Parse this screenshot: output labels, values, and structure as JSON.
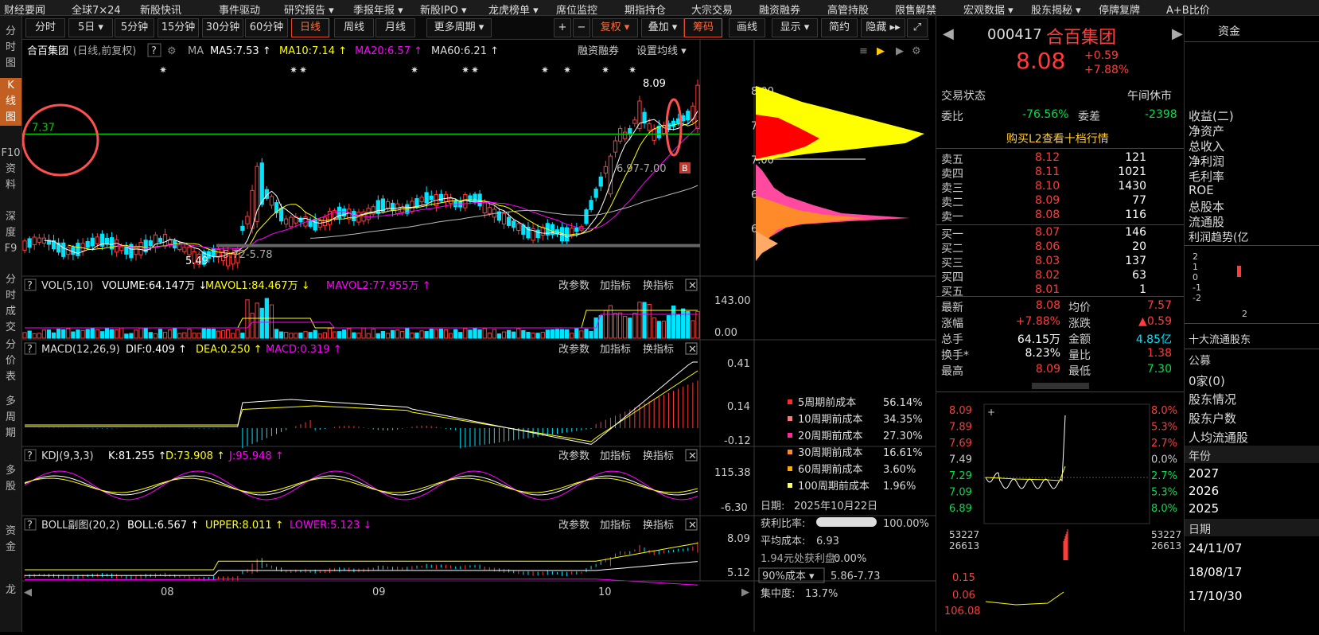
{
  "topnav": [
    "财经要闻",
    "全球7×24",
    "新股快讯",
    "事件驱动",
    "研究报告 ▾",
    "季报年报 ▾",
    "新股IPO ▾",
    "龙虎榜单 ▾",
    "席位监控",
    "期指持仓",
    "大宗交易",
    "融资融券",
    "高管持股",
    "限售解禁",
    "宏观数据 ▾",
    "股东揭秘 ▾",
    "停牌复牌",
    "A+B比价"
  ],
  "leftnav": [
    "分\n时\n图",
    "K\n线\n图",
    "F10\n资\n料",
    "深\n度\nF9",
    "分\n时\n成\n交",
    "分\n价\n表",
    "多\n周\n期",
    "多\n股",
    "资\n金",
    "龙"
  ],
  "toolbar": {
    "items": [
      "分时",
      "5日 ▾",
      "5分钟",
      "15分钟",
      "30分钟",
      "60分钟",
      "日线",
      "周线",
      "月线",
      "更多周期 ▾",
      "+",
      "−",
      "复权 ▾",
      "叠加 ▾",
      "筹码",
      "画线",
      "显示 ▾",
      "简约",
      "隐藏 ▸▸",
      "⤢"
    ]
  },
  "main": {
    "stock": "合百集团",
    "mode": "(日线,前复权)",
    "help": "?",
    "ma_label": "MA",
    "ma5": "MA5:7.53 ↑",
    "ma10": "MA10:7.14 ↑",
    "ma20": "MA20:6.57 ↑",
    "ma60": "MA60:6.21 ↑",
    "margin": "融资融券",
    "settings": "设置均线 ▾",
    "high_mark": "8.09",
    "low_mark": "5.49",
    "hline": "7.37",
    "range1": "5.72-5.78",
    "range2": "6.97-7.00",
    "b_badge": "B",
    "price_axis": [
      "8.00",
      "7.50",
      "7.00",
      "6.50",
      "6.00"
    ]
  },
  "vol": {
    "title": "VOL(5,10)",
    "volume": "VOLUME:64.147万 ↓",
    "mavol1": "MAVOL1:84.467万 ↓",
    "mavol2": "MAVOL2:77.955万 ↑",
    "axis": [
      "143.00",
      "0.00"
    ]
  },
  "macd": {
    "title": "MACD(12,26,9)",
    "dif": "DIF:0.409 ↑",
    "dea": "DEA:0.250 ↑",
    "macd": "MACD:0.319 ↑",
    "axis": [
      "0.41",
      "0.14",
      "-0.12"
    ]
  },
  "kdj": {
    "title": "KDJ(9,3,3)",
    "k": "K:81.255 ↑",
    "d": "D:73.908 ↑",
    "j": "J:95.948 ↑",
    "axis": [
      "115.38",
      "-6.30"
    ]
  },
  "boll": {
    "title": "BOLL副图(20,2)",
    "boll": "BOLL:6.567 ↑",
    "upper": "UPPER:8.011 ↑",
    "lower": "LOWER:5.123 ↓",
    "axis": [
      "8.09",
      "5.12"
    ]
  },
  "panel_actions": [
    "改参数",
    "加指标",
    "换指标"
  ],
  "xaxis": [
    "08",
    "09",
    "10"
  ],
  "chip": {
    "legend": [
      {
        "label": "5周期前成本",
        "value": "56.14%",
        "color": "#ff2a2a"
      },
      {
        "label": "10周期前成本",
        "value": "34.35%",
        "color": "#ff7777"
      },
      {
        "label": "20周期前成本",
        "value": "27.30%",
        "color": "#ff2aa0"
      },
      {
        "label": "30周期前成本",
        "value": "16.61%",
        "color": "#ff8a2a"
      },
      {
        "label": "60周期前成本",
        "value": "3.60%",
        "color": "#ffaa00"
      },
      {
        "label": "100周期前成本",
        "value": "1.96%",
        "color": "#ffff66"
      }
    ],
    "date_label": "日期:",
    "date": "2025年10月22日",
    "ratio_label": "获利比率:",
    "ratio": "100.00%",
    "avg_label": "平均成本:",
    "avg": "6.93",
    "profit_label": "1.94元处获利盘:",
    "profit": "0.00%",
    "cost_select": "90%成本 ▾",
    "cost_range": "5.86-7.73",
    "conc_label": "集中度:",
    "conc": "13.7%"
  },
  "right": {
    "code": "000417",
    "name": "合百集团",
    "price": "8.08",
    "change": "+0.59",
    "pct": "+7.88%",
    "status_label": "交易状态",
    "status": "午间休市",
    "wb_label": "委比",
    "wb": "-76.56%",
    "wc_label": "委差",
    "wc": "-2398",
    "l2": "购买L2查看十档行情",
    "sell": [
      {
        "l": "卖五",
        "p": "8.12",
        "v": "121"
      },
      {
        "l": "卖四",
        "p": "8.11",
        "v": "1021"
      },
      {
        "l": "卖三",
        "p": "8.10",
        "v": "1430"
      },
      {
        "l": "卖二",
        "p": "8.09",
        "v": "77"
      },
      {
        "l": "卖一",
        "p": "8.08",
        "v": "116"
      }
    ],
    "buy": [
      {
        "l": "买一",
        "p": "8.07",
        "v": "146"
      },
      {
        "l": "买二",
        "p": "8.06",
        "v": "20"
      },
      {
        "l": "买三",
        "p": "8.03",
        "v": "137"
      },
      {
        "l": "买四",
        "p": "8.02",
        "v": "63"
      },
      {
        "l": "买五",
        "p": "8.01",
        "v": "1"
      }
    ],
    "stats": [
      [
        "最新",
        "8.08",
        "均价",
        "7.57"
      ],
      [
        "涨幅",
        "+7.88%",
        "涨跌",
        "▲0.59"
      ],
      [
        "总手",
        "64.15万",
        "金额",
        "4.85亿"
      ],
      [
        "换手*",
        "8.23%",
        "量比",
        "1.38"
      ],
      [
        "最高",
        "8.09",
        "最低",
        "7.30"
      ]
    ],
    "mini_left": [
      "8.09",
      "7.89",
      "7.69",
      "7.49",
      "7.29",
      "7.09",
      "6.89"
    ],
    "mini_right": [
      "8.0%",
      "5.3%",
      "2.7%",
      "0.0%",
      "2.7%",
      "5.3%",
      "8.0%"
    ],
    "mini_vol": [
      "53227",
      "26613"
    ],
    "mini_vol_r": [
      "53227",
      "26613"
    ],
    "mini_macd": [
      "0.15",
      "0.06",
      "106.08"
    ]
  },
  "far": {
    "tab": "资金",
    "items": [
      "收益(二)",
      "净资产",
      "总收入",
      "净利润",
      "毛利率",
      "ROE",
      "总股本",
      "流通股"
    ],
    "trend": "利润趋势(亿",
    "trend_axis": [
      "2",
      "1",
      "0",
      "-1",
      "-2"
    ],
    "trend_x": "2",
    "top10": "十大流通股东",
    "gong": "公募",
    "zero": "0家(0)",
    "sh1": "股东情况",
    "sh2": "股东户数",
    "sh3": "人均流通股",
    "year_label": "年份",
    "years": [
      "2027",
      "2026",
      "2025"
    ],
    "date_label": "日期",
    "dates": [
      "24/11/07",
      "18/08/17",
      "17/10/30"
    ]
  }
}
